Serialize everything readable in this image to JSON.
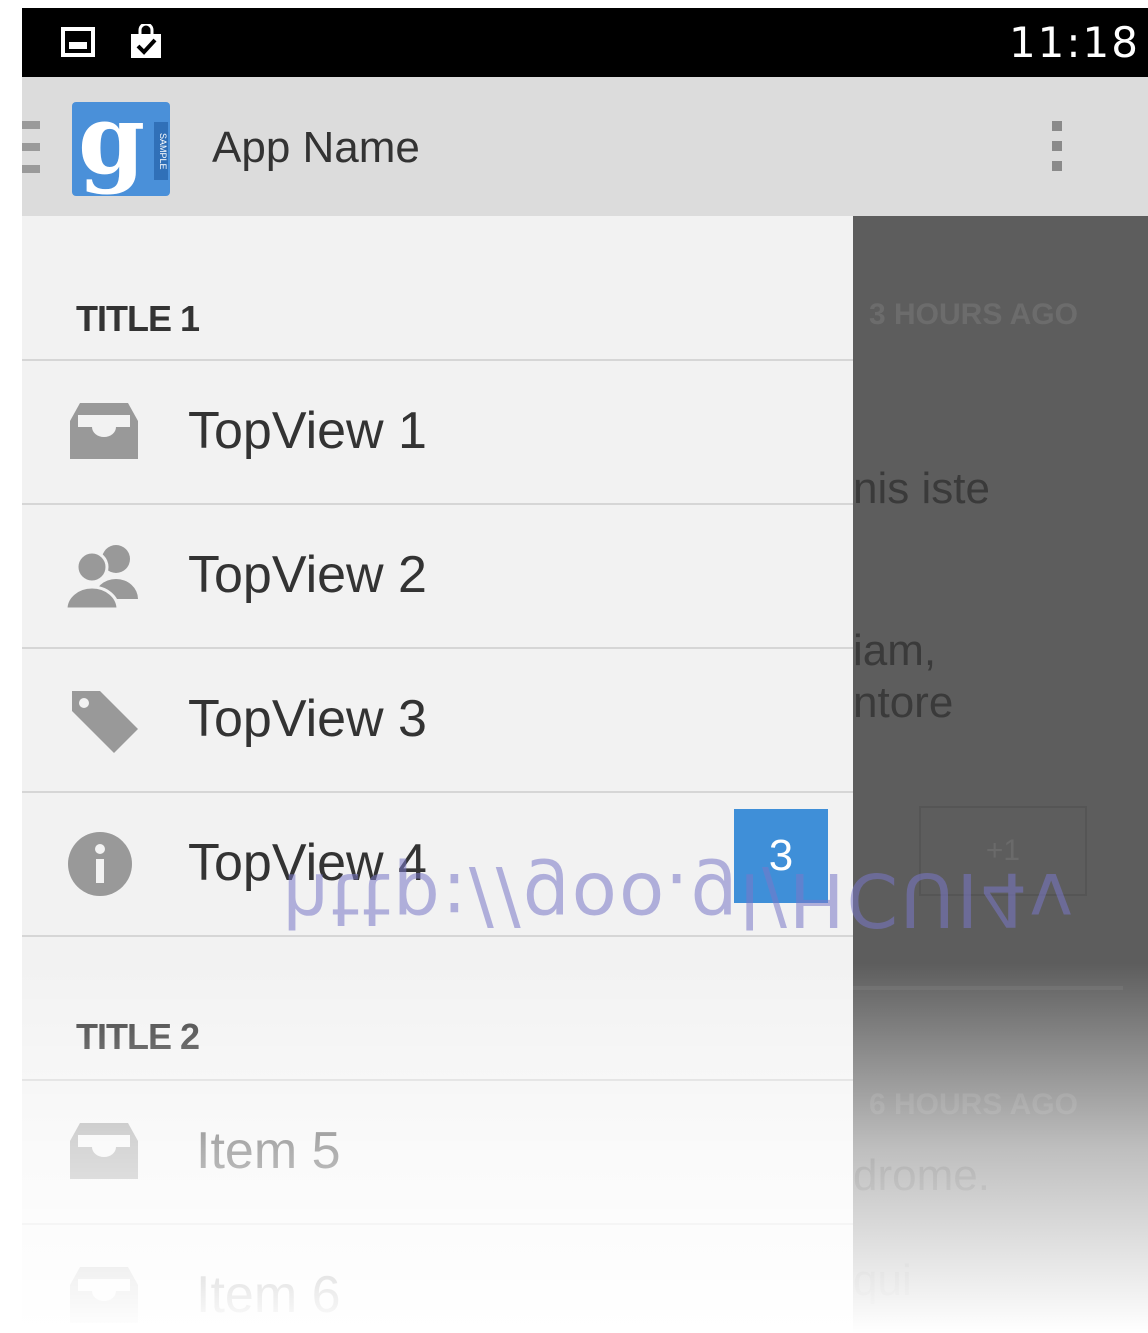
{
  "status_bar": {
    "time": "11:18",
    "icons": [
      "image-icon",
      "shopping-bag-check-icon"
    ]
  },
  "action_bar": {
    "app_title": "App Name",
    "logo_letter": "g",
    "logo_tag": "SAMPLE",
    "icons": [
      "drawer-indicator-icon",
      "overflow-menu-icon"
    ]
  },
  "drawer": {
    "section1_title": "TITLE 1",
    "section2_title": "TITLE 2",
    "items": [
      {
        "label": "TopView 1",
        "icon": "inbox-icon"
      },
      {
        "label": "TopView 2",
        "icon": "people-icon"
      },
      {
        "label": "TopView 3",
        "icon": "tag-icon"
      },
      {
        "label": "TopView 4",
        "icon": "info-icon",
        "badge": "3"
      },
      {
        "label": "Item 5",
        "icon": "inbox-icon"
      },
      {
        "label": "Item 6",
        "icon": "inbox-icon"
      }
    ]
  },
  "background_content": {
    "meta1": "3 HOURS AGO",
    "text1": "nis iste",
    "text2a": "iam,",
    "text2b": "ntore",
    "button": "+1",
    "meta2": "6 HOURS AGO",
    "text3": "drome.",
    "text4": "qui"
  },
  "watermark": "http://goo.gl/HCUI4v",
  "colors": {
    "accent": "#3f8fd8",
    "status_bar": "#000000",
    "action_bar": "#dcdcdc",
    "drawer_bg": "#f2f2f2",
    "scrim": "#5d5d5d"
  }
}
